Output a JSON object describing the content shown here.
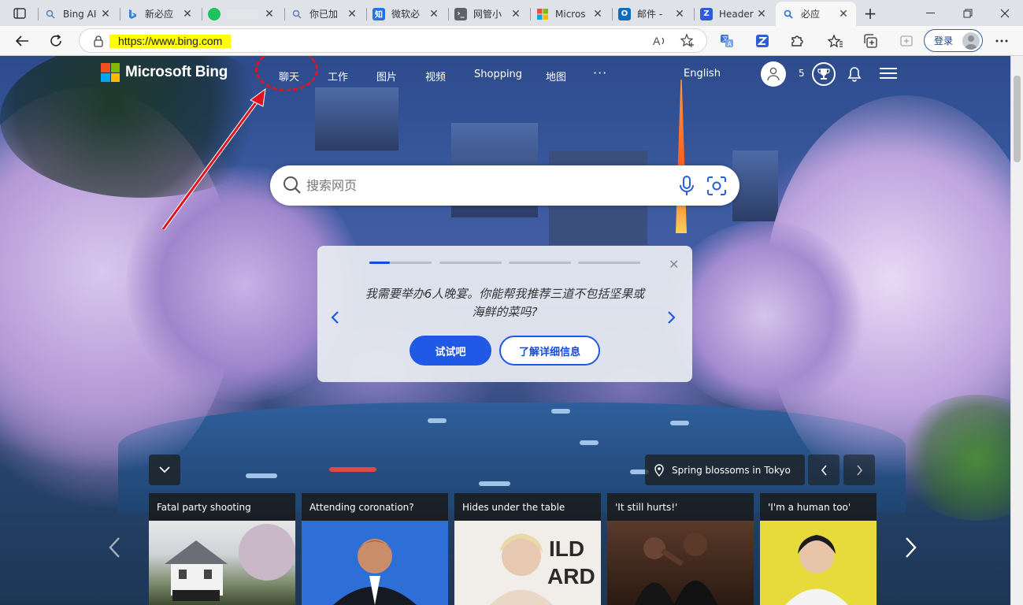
{
  "tabs": [
    {
      "title": "Bing AI",
      "favicon": "search-icon"
    },
    {
      "title": "新必应",
      "favicon": "bing-icon"
    },
    {
      "title": "",
      "favicon": "wechat-icon"
    },
    {
      "title": "你已加",
      "favicon": "search-icon"
    },
    {
      "title": "微软必",
      "favicon": "zhihu-icon"
    },
    {
      "title": "网管小",
      "favicon": "terminal-icon"
    },
    {
      "title": "Micros",
      "favicon": "microsoft-icon"
    },
    {
      "title": "邮件 -",
      "favicon": "outlook-icon"
    },
    {
      "title": "Header",
      "favicon": "z-icon"
    },
    {
      "title": "必应",
      "favicon": "search-icon",
      "active": true
    }
  ],
  "toolbar": {
    "url": "https://www.bing.com",
    "sign_in": "登录"
  },
  "nav": {
    "logo": "Microsoft Bing",
    "items": [
      "聊天",
      "工作",
      "图片",
      "视频",
      "Shopping",
      "地图",
      "···"
    ],
    "language": "English",
    "points": "5"
  },
  "search": {
    "placeholder": "搜索网页"
  },
  "carousel": {
    "prompt": "我需要举办6人晚宴。你能帮我推荐三道不包括坚果或海鲜的菜吗?",
    "try_label": "试试吧",
    "more_label": "了解详细信息",
    "steps": 4,
    "current_step": 1
  },
  "location": {
    "label": "Spring blossoms in Tokyo"
  },
  "news": [
    {
      "headline": "Fatal party shooting"
    },
    {
      "headline": "Attending coronation?"
    },
    {
      "headline": "Hides under the table"
    },
    {
      "headline": "'It still hurts!'"
    },
    {
      "headline": "'I'm a human too'"
    }
  ],
  "colors": {
    "accent": "#1f59e6",
    "annotation": "#e0141e",
    "url_highlight": "#ffff00"
  }
}
